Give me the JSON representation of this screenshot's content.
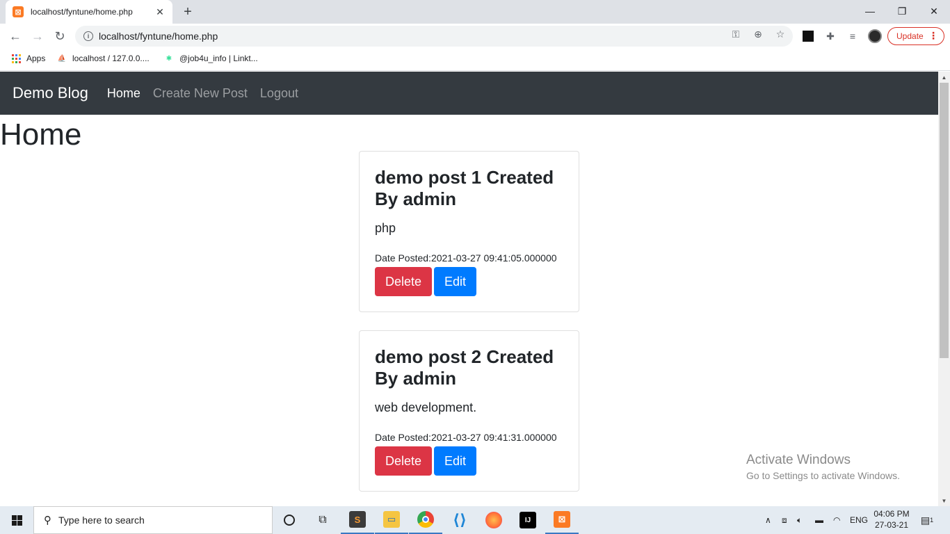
{
  "browser": {
    "tab_title": "localhost/fyntune/home.php",
    "url": "localhost/fyntune/home.php",
    "update_label": "Update",
    "bookmarks": [
      {
        "label": "Apps"
      },
      {
        "label": "localhost / 127.0.0...."
      },
      {
        "label": "@job4u_info | Linkt..."
      }
    ]
  },
  "navbar": {
    "brand": "Demo Blog",
    "links": [
      {
        "label": "Home",
        "active": true
      },
      {
        "label": "Create New Post",
        "active": false
      },
      {
        "label": "Logout",
        "active": false
      }
    ]
  },
  "page": {
    "title": "Home",
    "posts": [
      {
        "title": "demo post 1 Created By admin",
        "body": "php",
        "date": "Date Posted:2021-03-27 09:41:05.000000",
        "delete_label": "Delete",
        "edit_label": "Edit"
      },
      {
        "title": "demo post 2 Created By admin",
        "body": "web development.",
        "date": "Date Posted:2021-03-27 09:41:31.000000",
        "delete_label": "Delete",
        "edit_label": "Edit"
      }
    ]
  },
  "watermark": {
    "title": "Activate Windows",
    "subtitle": "Go to Settings to activate Windows."
  },
  "taskbar": {
    "search_placeholder": "Type here to search",
    "language": "ENG",
    "time": "04:06 PM",
    "date": "27-03-21",
    "notification_count": "1"
  },
  "colors": {
    "navbar_bg": "#343a40",
    "danger": "#dc3545",
    "primary": "#007bff"
  }
}
